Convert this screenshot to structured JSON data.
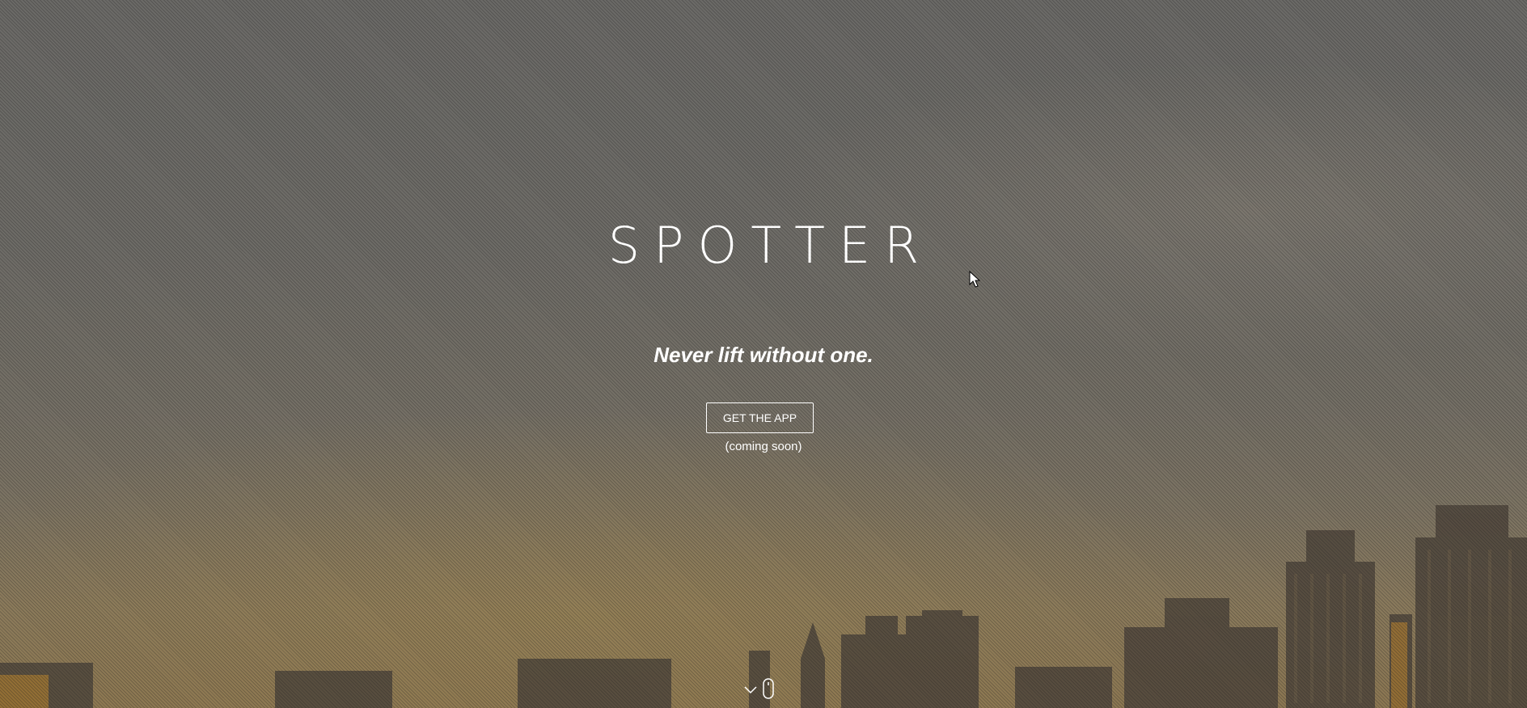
{
  "hero": {
    "brand": "SPOTTER",
    "tagline": "Never lift without one.",
    "cta_label": "GET THE APP",
    "cta_note": "(coming soon)"
  },
  "icons": {
    "scroll_chevron": "chevron-down-icon",
    "scroll_mouse": "mouse-icon",
    "pointer": "cursor-icon"
  },
  "colors": {
    "text": "#ffffff",
    "sky_top": "#6b6a67",
    "sky_bottom": "#8c7752",
    "buildings": "#4f463c"
  }
}
